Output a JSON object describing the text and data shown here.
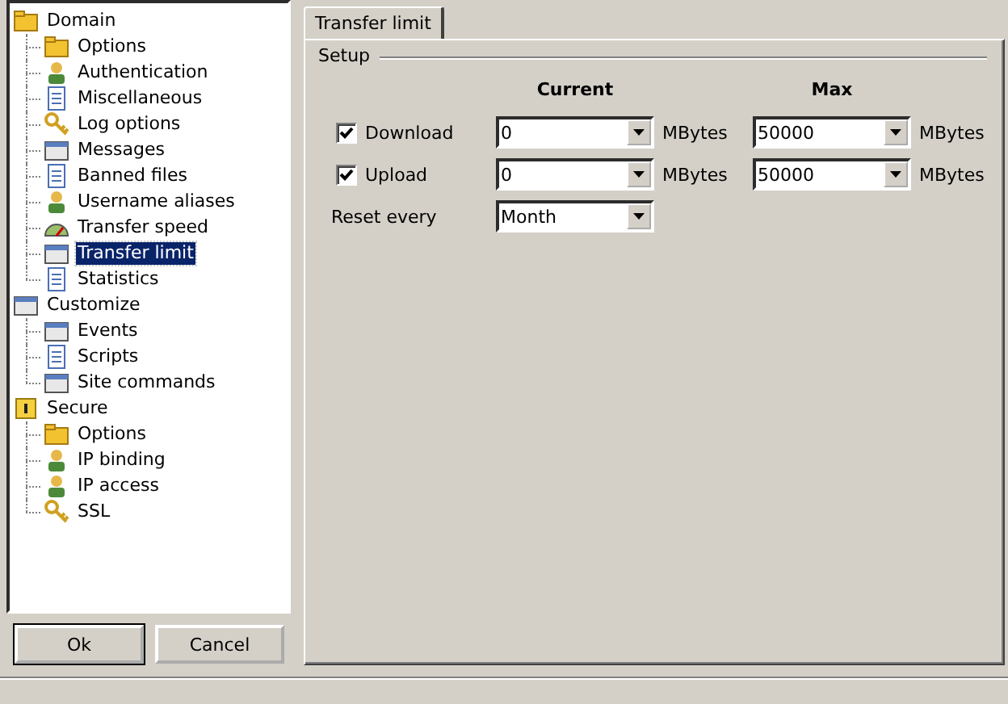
{
  "tree": [
    {
      "label": "Domain",
      "selected": false,
      "children": [
        {
          "label": "Options",
          "selected": false
        },
        {
          "label": "Authentication",
          "selected": false
        },
        {
          "label": "Miscellaneous",
          "selected": false
        },
        {
          "label": "Log options",
          "selected": false
        },
        {
          "label": "Messages",
          "selected": false
        },
        {
          "label": "Banned files",
          "selected": false
        },
        {
          "label": "Username aliases",
          "selected": false
        },
        {
          "label": "Transfer speed",
          "selected": false
        },
        {
          "label": "Transfer limit",
          "selected": true
        },
        {
          "label": "Statistics",
          "selected": false
        }
      ]
    },
    {
      "label": "Customize",
      "selected": false,
      "children": [
        {
          "label": "Events",
          "selected": false
        },
        {
          "label": "Scripts",
          "selected": false
        },
        {
          "label": "Site commands",
          "selected": false
        }
      ]
    },
    {
      "label": "Secure",
      "selected": false,
      "children": [
        {
          "label": "Options",
          "selected": false
        },
        {
          "label": "IP binding",
          "selected": false
        },
        {
          "label": "IP access",
          "selected": false
        },
        {
          "label": "SSL",
          "selected": false
        }
      ]
    }
  ],
  "buttons": [
    {
      "label": "Ok",
      "default": true
    },
    {
      "label": "Cancel",
      "default": false
    }
  ],
  "tabs": [
    {
      "label": "Transfer limit",
      "selected": true
    }
  ],
  "group": {
    "title": "Setup",
    "columns": [
      "Current",
      "Max"
    ],
    "rows": [
      {
        "kind": "check",
        "label": "Download",
        "checked": true,
        "current": "0",
        "current_unit": "MBytes",
        "max": "50000",
        "max_unit": "MBytes"
      },
      {
        "kind": "check",
        "label": "Upload",
        "checked": true,
        "current": "0",
        "current_unit": "MBytes",
        "max": "50000",
        "max_unit": "MBytes"
      },
      {
        "kind": "plain",
        "label": "Reset every",
        "current": "Month"
      }
    ]
  }
}
